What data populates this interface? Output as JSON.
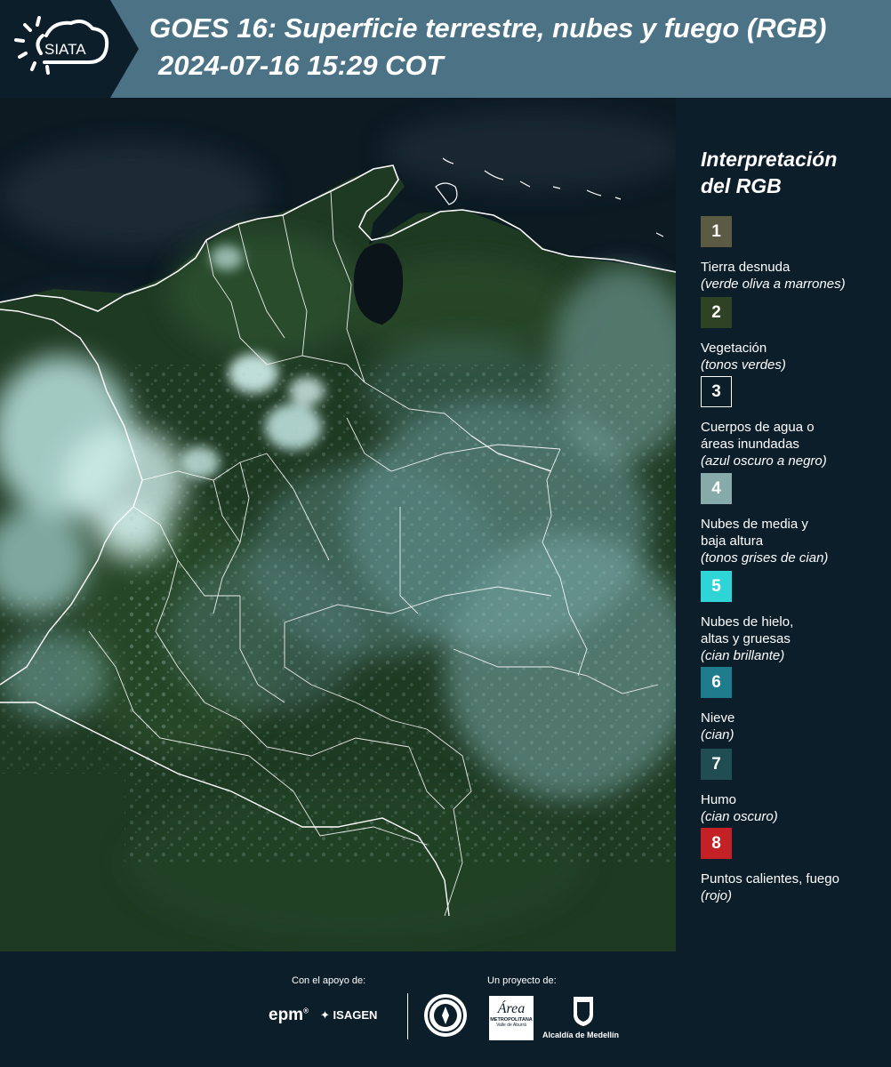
{
  "header": {
    "logo_text": "SIATA",
    "title_line1": "GOES 16: Superficie terrestre, nubes y fuego (RGB)",
    "title_line2": "2024-07-16 15:29 COT"
  },
  "legend": {
    "title_line1": "Interpretación",
    "title_line2": "del RGB",
    "items": [
      {
        "number": "1",
        "color": "#5a5b42",
        "label_lines": [
          "Tierra desnuda"
        ],
        "desc": "(verde oliva a marrones)"
      },
      {
        "number": "2",
        "color": "#2d4323",
        "label_lines": [
          "Vegetación"
        ],
        "desc": "(tonos verdes)"
      },
      {
        "number": "3",
        "color": "#0d1e2b",
        "label_lines": [
          "Cuerpos de agua o",
          "áreas inundadas"
        ],
        "desc": "(azul oscuro a negro)"
      },
      {
        "number": "4",
        "color": "#87aaab",
        "label_lines": [
          "Nubes de media y",
          "baja altura"
        ],
        "desc": "(tonos grises de cian)"
      },
      {
        "number": "5",
        "color": "#2fd4d6",
        "label_lines": [
          "Nubes de hielo,",
          "altas y gruesas"
        ],
        "desc": "(cian brillante)"
      },
      {
        "number": "6",
        "color": "#1f7c8d",
        "label_lines": [
          "Nieve"
        ],
        "desc": "(cian)"
      },
      {
        "number": "7",
        "color": "#1f4d52",
        "label_lines": [
          "Humo"
        ],
        "desc": "(cian oscuro)"
      },
      {
        "number": "8",
        "color": "#c42126",
        "label_lines": [
          "Puntos calientes, fuego"
        ],
        "desc": "(rojo)"
      }
    ]
  },
  "footer": {
    "support_label": "Con el apoyo de:",
    "project_label": "Un proyecto de:",
    "sponsors": [
      "epm",
      "ISAGEN"
    ],
    "partners": [
      "Área",
      "METROPOLITANA",
      "Valle de Aburrá",
      "Alcaldía de Medellín"
    ]
  }
}
